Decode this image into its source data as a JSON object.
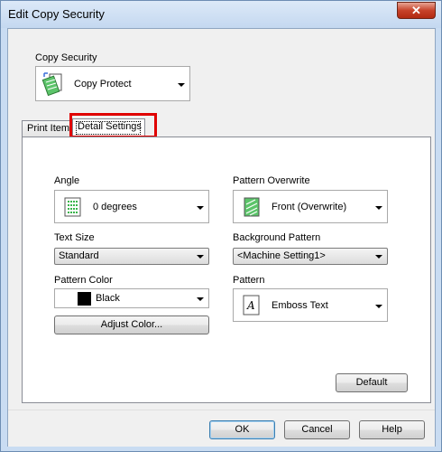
{
  "window": {
    "title": "Edit Copy Security",
    "close_glyph": "✕"
  },
  "copy_security": {
    "label": "Copy Security",
    "value": "Copy Protect",
    "icon": "copy-protect-icon"
  },
  "tabs": [
    {
      "label": "Print Item",
      "selected": false
    },
    {
      "label": "Detail Settings",
      "selected": true
    }
  ],
  "detail": {
    "angle": {
      "label": "Angle",
      "value": "0 degrees",
      "icon": "angle-pattern-icon"
    },
    "pattern_overwrite": {
      "label": "Pattern Overwrite",
      "value": "Front (Overwrite)",
      "icon": "overwrite-pattern-icon"
    },
    "text_size": {
      "label": "Text Size",
      "value": "Standard"
    },
    "background_pattern": {
      "label": "Background Pattern",
      "value": "<Machine Setting1>"
    },
    "pattern_color": {
      "label": "Pattern Color",
      "value": "Black",
      "swatch": "#000000"
    },
    "pattern": {
      "label": "Pattern",
      "value": "Emboss Text",
      "icon": "emboss-text-icon"
    },
    "adjust_color_label": "Adjust Color...",
    "default_label": "Default"
  },
  "footer": {
    "ok_label": "OK",
    "cancel_label": "Cancel",
    "help_label": "Help"
  },
  "colors": {
    "highlight": "#e00000",
    "pattern_green": "#38b44a"
  }
}
